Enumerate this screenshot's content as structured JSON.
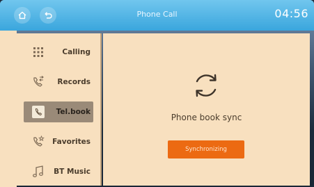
{
  "header": {
    "title": "Phone Call",
    "time": "04:56",
    "home_icon": "home-icon",
    "back_icon": "back-icon"
  },
  "sidebar": {
    "items": [
      {
        "label": "Calling",
        "icon": "dialpad-icon",
        "active": false
      },
      {
        "label": "Records",
        "icon": "call-records-icon",
        "active": false
      },
      {
        "label": "Tel.book",
        "icon": "phonebook-icon",
        "active": true
      },
      {
        "label": "Favorites",
        "icon": "favorites-icon",
        "active": false
      },
      {
        "label": "BT Music",
        "icon": "music-note-icon",
        "active": false
      }
    ]
  },
  "main": {
    "status_text": "Phone book sync",
    "button_label": "Synchronizing",
    "sync_icon": "sync-icon"
  },
  "colors": {
    "topbar": "#3aa6dd",
    "panel": "#f8e0bf",
    "button": "#ec6a12",
    "active_item": "#9a8a78"
  }
}
